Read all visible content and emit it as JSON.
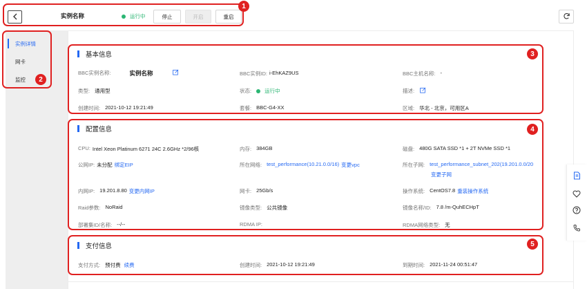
{
  "header": {
    "title": "实例名称",
    "status": "运行中",
    "buttons": {
      "stop": "停止",
      "start": "开启",
      "restart": "重启"
    }
  },
  "sidebar": {
    "items": [
      {
        "label": "实例详情"
      },
      {
        "label": "网卡"
      },
      {
        "label": "监控"
      }
    ]
  },
  "badges": [
    "1",
    "2",
    "3",
    "4",
    "5"
  ],
  "basic": {
    "title": "基本信息",
    "name_label": "BBC实例名称:",
    "name_value": "实例名称",
    "id_label": "BBC实例ID:",
    "id_value": "i-EhKAZ9US",
    "host_label": "BBC主机名称:",
    "host_value": "-",
    "type_label": "类型:",
    "type_value": "通用型",
    "state_label": "状态:",
    "state_value": "运行中",
    "desc_label": "描述:",
    "created_label": "创建时间:",
    "created_value": "2021-10-12 19:21:49",
    "package_label": "套餐:",
    "package_value": "BBC-G4-XX",
    "region_label": "区域:",
    "region_value": "华北 - 北京，可用区A"
  },
  "config": {
    "title": "配置信息",
    "cpu_label": "CPU:",
    "cpu_value": "Intel Xeon Platinum 6271 24C 2.6GHz *2/96核",
    "mem_label": "内存:",
    "mem_value": "384GB",
    "disk_label": "磁盘:",
    "disk_value": "480G SATA SSD *1 + 2T NVMe SSD *1",
    "pubip_label": "公网IP:",
    "pubip_value": "未分配",
    "pubip_link": "绑定EIP",
    "net_label": "所在网络:",
    "net_value": "test_performance(10.21.0.0/16)",
    "net_link": "变更vpc",
    "subnet_label": "所在子网:",
    "subnet_value": "test_performance_subnet_202(19.201.0.0/20",
    "subnet_link": "变更子网",
    "intip_label": "内网IP:",
    "intip_value": "19.201.8.80",
    "intip_link": "变更内网IP",
    "nic_label": "网卡:",
    "nic_value": "25Gb/s",
    "os_label": "操作系统:",
    "os_value": "CentOS7.8",
    "os_link": "重装操作系统",
    "raid_label": "Raid参数:",
    "raid_value": "NoRaid",
    "imgtype_label": "镜像类型:",
    "imgtype_value": "公共镜像",
    "imgname_label": "镜像名称/ID:",
    "imgname_value": "7.8 /m-QuhECHpT",
    "deploy_label": "部署集ID/名称:",
    "deploy_value": "--/--",
    "rdmaip_label": "RDMA IP:",
    "rdmaip_value": "",
    "rdmatype_label": "RDMA网络类型:",
    "rdmatype_value": "无"
  },
  "payment": {
    "title": "支付信息",
    "method_label": "支付方式:",
    "method_value": "预付费",
    "method_link": "续费",
    "created_label": "创建时间:",
    "created_value": "2021-10-12 19:21:49",
    "expire_label": "到期时间:",
    "expire_value": "2021-11-24 00:51:47"
  },
  "icons": [
    "back-arrow-icon",
    "refresh-icon",
    "edit-icon",
    "document-icon",
    "heart-icon",
    "help-icon",
    "phone-icon"
  ],
  "colors": {
    "accent": "#2468f2",
    "success": "#2bb673",
    "annotation": "#e02020"
  }
}
